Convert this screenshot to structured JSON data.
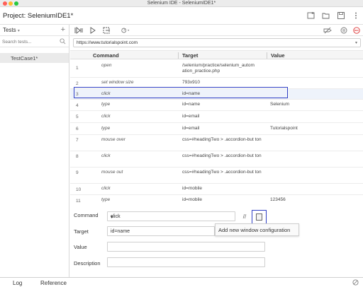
{
  "window": {
    "title": "Selenium IDE - SeleniumIDE1*"
  },
  "header": {
    "project_label": "Project:",
    "project_name": "SeleniumIDE1*",
    "icons": [
      "new-project-icon",
      "open-project-icon",
      "save-project-icon",
      "more-vert-icon"
    ]
  },
  "sidebar": {
    "tests_label": "Tests",
    "add_label": "+",
    "search_placeholder": "Search tests...",
    "items": [
      {
        "label": "TestCase1*"
      }
    ]
  },
  "toolbar": {
    "icons": [
      "run-all-icon",
      "run-icon",
      "step-icon",
      "speed-icon",
      "disable-breakpoints-icon",
      "pause-icon",
      "record-icon"
    ]
  },
  "url": {
    "value": "https://www.tutorialspoint.com"
  },
  "table": {
    "headers": {
      "command": "Command",
      "target": "Target",
      "value": "Value"
    },
    "rows": [
      {
        "num": "1",
        "command": "open",
        "target": "/selenium/practice/selenium_autom ation_practice.php",
        "value": ""
      },
      {
        "num": "2",
        "command": "set window size",
        "target": "793x910",
        "value": ""
      },
      {
        "num": "3",
        "command": "click",
        "target": "id=name",
        "value": ""
      },
      {
        "num": "4",
        "command": "type",
        "target": "id=name",
        "value": "Selenium"
      },
      {
        "num": "5",
        "command": "click",
        "target": "id=email",
        "value": ""
      },
      {
        "num": "6",
        "command": "type",
        "target": "id=email",
        "value": "Tutorialspoint"
      },
      {
        "num": "7",
        "command": "mouse over",
        "target": "css=#headingTwo > .accordion-but ton",
        "value": ""
      },
      {
        "num": "8",
        "command": "click",
        "target": "css=#headingTwo > .accordion-but ton",
        "value": ""
      },
      {
        "num": "9",
        "command": "mouse out",
        "target": "css=#headingTwo > .accordion-but ton",
        "value": ""
      },
      {
        "num": "10",
        "command": "click",
        "target": "id=mobile",
        "value": ""
      },
      {
        "num": "11",
        "command": "type",
        "target": "id=mobile",
        "value": "123456"
      }
    ]
  },
  "editor": {
    "command_label": "Command",
    "command_value": "click",
    "target_label": "Target",
    "target_value": "id=name",
    "value_label": "Value",
    "value_value": "",
    "description_label": "Description",
    "description_value": "",
    "slash_label": "//",
    "tooltip": "Add new window configuration"
  },
  "footer": {
    "log_label": "Log",
    "reference_label": "Reference"
  }
}
